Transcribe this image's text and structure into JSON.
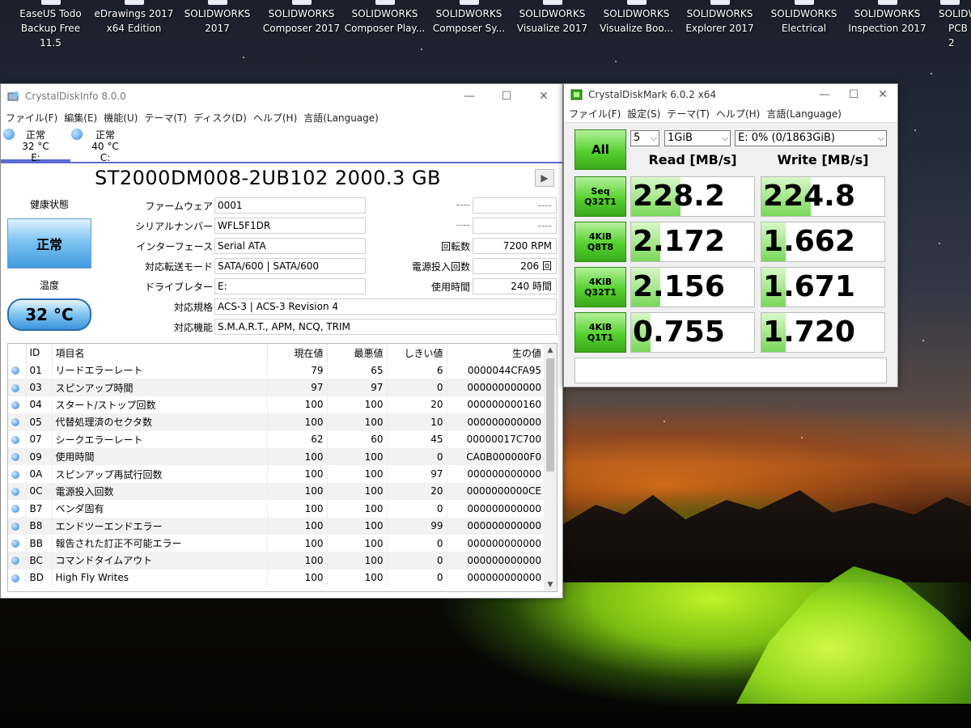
{
  "desktop": {
    "icons": [
      {
        "line1": "EaseUS Todo",
        "line2": "Backup Free 11.5"
      },
      {
        "line1": "eDrawings 2017",
        "line2": "x64 Edition"
      },
      {
        "line1": "SOLIDWORKS",
        "line2": "2017"
      },
      {
        "line1": "SOLIDWORKS",
        "line2": "Composer 2017"
      },
      {
        "line1": "SOLIDWORKS",
        "line2": "Composer Play..."
      },
      {
        "line1": "SOLIDWORKS",
        "line2": "Composer Sy..."
      },
      {
        "line1": "SOLIDWORKS",
        "line2": "Visualize 2017"
      },
      {
        "line1": "SOLIDWORKS",
        "line2": "Visualize Boo..."
      },
      {
        "line1": "SOLIDWORKS",
        "line2": "Explorer 2017"
      },
      {
        "line1": "SOLIDWORKS",
        "line2": "Electrical"
      },
      {
        "line1": "SOLIDWORKS",
        "line2": "Inspection 2017"
      },
      {
        "line1": "SOLIDW",
        "line2": "PCB 2"
      }
    ],
    "badge": "2017"
  },
  "cdi": {
    "title": "CrystalDiskInfo 8.0.0",
    "menu": [
      "ファイル(F)",
      "編集(E)",
      "機能(U)",
      "テーマ(T)",
      "ディスク(D)",
      "ヘルプ(H)",
      "言語(Language)"
    ],
    "drives": [
      {
        "status": "正常",
        "temp": "32 °C",
        "letter": "E:"
      },
      {
        "status": "正常",
        "temp": "40 °C",
        "letter": "C:"
      }
    ],
    "model": "ST2000DM008-2UB102 2000.3 GB",
    "health_label": "健康状態",
    "health_value": "正常",
    "temp_label": "温度",
    "temp_value": "32 °C",
    "fields": {
      "firmware_label": "ファームウェア",
      "firmware": "0001",
      "serial_label": "シリアルナンバー",
      "serial": "WFL5F1DR",
      "interface_label": "インターフェース",
      "interface": "Serial ATA",
      "transfer_label": "対応転送モード",
      "transfer": "SATA/600 | SATA/600",
      "drive_letter_label": "ドライブレター",
      "drive_letter": "E:",
      "standard_label": "対応規格",
      "standard": "ACS-3 | ACS-3 Revision 4",
      "features_label": "対応機能",
      "features": "S.M.A.R.T., APM, NCQ, TRIM",
      "blank1_label": "----",
      "blank1": "----",
      "blank2_label": "----",
      "blank2": "----",
      "rpm_label": "回転数",
      "rpm": "7200 RPM",
      "power_count_label": "電源投入回数",
      "power_count": "206 回",
      "power_hours_label": "使用時間",
      "power_hours": "240 時間"
    },
    "smart_headers": [
      "ID",
      "項目名",
      "現在値",
      "最悪値",
      "しきい値",
      "生の値"
    ],
    "smart_rows": [
      [
        "01",
        "リードエラーレート",
        "79",
        "65",
        "6",
        "0000044CFA95"
      ],
      [
        "03",
        "スピンアップ時間",
        "97",
        "97",
        "0",
        "000000000000"
      ],
      [
        "04",
        "スタート/ストップ回数",
        "100",
        "100",
        "20",
        "000000000160"
      ],
      [
        "05",
        "代替処理済のセクタ数",
        "100",
        "100",
        "10",
        "000000000000"
      ],
      [
        "07",
        "シークエラーレート",
        "62",
        "60",
        "45",
        "00000017C700"
      ],
      [
        "09",
        "使用時間",
        "100",
        "100",
        "0",
        "CA0B000000F0"
      ],
      [
        "0A",
        "スピンアップ再試行回数",
        "100",
        "100",
        "97",
        "000000000000"
      ],
      [
        "0C",
        "電源投入回数",
        "100",
        "100",
        "20",
        "0000000000CE"
      ],
      [
        "B7",
        "ベンダ固有",
        "100",
        "100",
        "0",
        "000000000000"
      ],
      [
        "B8",
        "エンドツーエンドエラー",
        "100",
        "100",
        "99",
        "000000000000"
      ],
      [
        "BB",
        "報告された訂正不可能エラー",
        "100",
        "100",
        "0",
        "000000000000"
      ],
      [
        "BC",
        "コマンドタイムアウト",
        "100",
        "100",
        "0",
        "000000000000"
      ],
      [
        "BD",
        "High Fly Writes",
        "100",
        "100",
        "0",
        "000000000000"
      ]
    ]
  },
  "cdm": {
    "title": "CrystalDiskMark 6.0.2 x64",
    "menu": [
      "ファイル(F)",
      "設定(S)",
      "テーマ(T)",
      "ヘルプ(H)",
      "言語(Language)"
    ],
    "all_label": "All",
    "count": "5",
    "size": "1GiB",
    "drive": "E: 0% (0/1863GiB)",
    "read_header": "Read [MB/s]",
    "write_header": "Write [MB/s]",
    "tests": [
      {
        "line1": "Seq",
        "line2": "Q32T1",
        "read": "228.2",
        "write": "224.8",
        "read_fill": 0.4,
        "write_fill": 0.4
      },
      {
        "line1": "4KiB",
        "line2": "Q8T8",
        "read": "2.172",
        "write": "1.662",
        "read_fill": 0.24,
        "write_fill": 0.2
      },
      {
        "line1": "4KiB",
        "line2": "Q32T1",
        "read": "2.156",
        "write": "1.671",
        "read_fill": 0.24,
        "write_fill": 0.2
      },
      {
        "line1": "4KiB",
        "line2": "Q1T1",
        "read": "0.755",
        "write": "1.720",
        "read_fill": 0.16,
        "write_fill": 0.2
      }
    ],
    "colors": {
      "accent": "#55d12f"
    }
  }
}
